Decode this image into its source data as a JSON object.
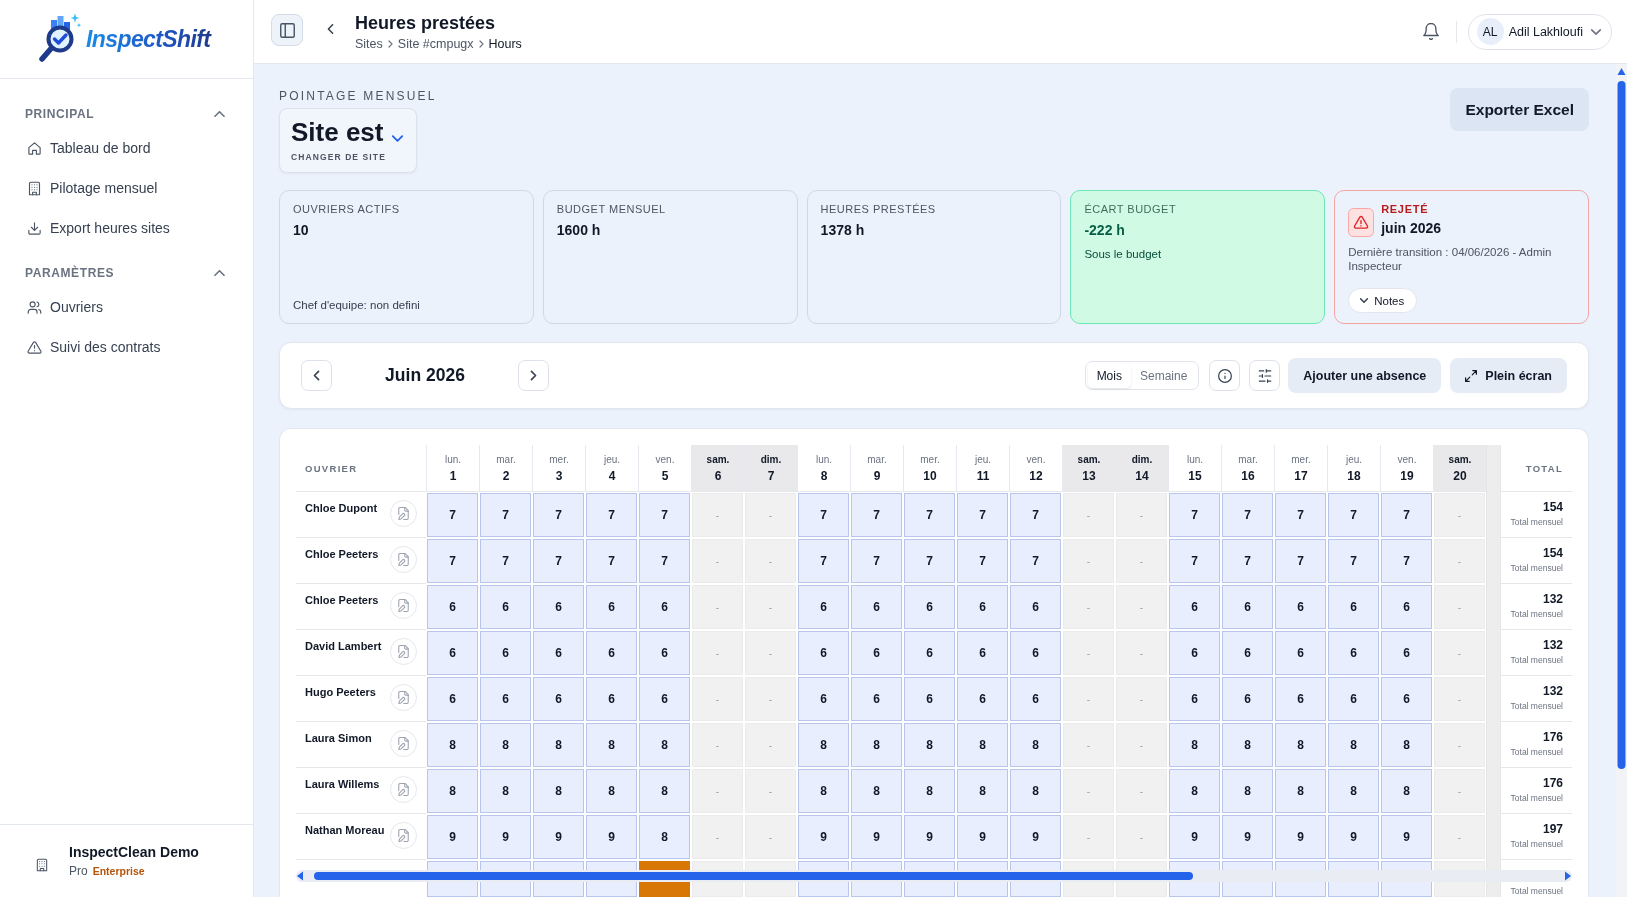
{
  "sidebar": {
    "logo": "InspectShift",
    "sections": [
      {
        "title": "PRINCIPAL",
        "expanded": true,
        "items": [
          {
            "label": "Tableau de bord",
            "selected": false
          },
          {
            "label": "Pilotage mensuel",
            "selected": false
          },
          {
            "label": "Export heures sites",
            "selected": false
          }
        ]
      },
      {
        "title": "PARAMÈTRES",
        "expanded": true,
        "items": [
          {
            "label": "Ouvriers",
            "selected": false
          },
          {
            "label": "Suivi des contrats",
            "selected": false
          }
        ]
      }
    ],
    "organization": {
      "name": "InspectClean Demo",
      "plan": "Pro",
      "tier": "Enterprise"
    }
  },
  "header": {
    "title": "Heures prestées",
    "breadcrumb": [
      {
        "label": "Sites",
        "current": false
      },
      {
        "label": "Site #cmpugx",
        "current": false
      },
      {
        "label": "Hours",
        "current": true
      }
    ],
    "user": {
      "initials": "AL",
      "name": "Adil Lakhloufi"
    }
  },
  "page": {
    "eyebrow": "POINTAGE MENSUEL",
    "site": {
      "name": "Site est",
      "action": "CHANGER DE SITE"
    },
    "export_button": "Exporter Excel"
  },
  "stats": [
    {
      "kind": "stat",
      "label": "OUVRIERS ACTIFS",
      "value": "10",
      "note": "Chef d'equipe: non defini"
    },
    {
      "kind": "stat",
      "label": "BUDGET MENSUEL",
      "value": "1600 h"
    },
    {
      "kind": "stat",
      "label": "HEURES PRESTÉES",
      "value": "1378 h"
    },
    {
      "kind": "positive",
      "label": "ÉCART BUDGET",
      "value": "-222 h",
      "note": "Sous le budget"
    },
    {
      "kind": "status",
      "label": "REJETÉ",
      "value": "juin 2026",
      "note": "Dernière transition : 04/06/2026 - Admin Inspecteur",
      "button": "Notes"
    }
  ],
  "toolbar": {
    "month": "Juin 2026",
    "view_modes": [
      {
        "label": "Mois",
        "selected": true
      },
      {
        "label": "Semaine",
        "selected": false
      }
    ],
    "add_absence": "Ajouter une absence",
    "fullscreen": "Plein écran"
  },
  "table": {
    "worker_header": "OUVRIER",
    "total_header": "TOTAL",
    "days": [
      {
        "weekday": "lun.",
        "day": "1",
        "weekend": false
      },
      {
        "weekday": "mar.",
        "day": "2",
        "weekend": false
      },
      {
        "weekday": "mer.",
        "day": "3",
        "weekend": false
      },
      {
        "weekday": "jeu.",
        "day": "4",
        "weekend": false
      },
      {
        "weekday": "ven.",
        "day": "5",
        "weekend": false
      },
      {
        "weekday": "sam.",
        "day": "6",
        "weekend": true
      },
      {
        "weekday": "dim.",
        "day": "7",
        "weekend": true
      },
      {
        "weekday": "lun.",
        "day": "8",
        "weekend": false
      },
      {
        "weekday": "mar.",
        "day": "9",
        "weekend": false
      },
      {
        "weekday": "mer.",
        "day": "10",
        "weekend": false
      },
      {
        "weekday": "jeu.",
        "day": "11",
        "weekend": false
      },
      {
        "weekday": "ven.",
        "day": "12",
        "weekend": false
      },
      {
        "weekday": "sam.",
        "day": "13",
        "weekend": true
      },
      {
        "weekday": "dim.",
        "day": "14",
        "weekend": true
      },
      {
        "weekday": "lun.",
        "day": "15",
        "weekend": false
      },
      {
        "weekday": "mar.",
        "day": "16",
        "weekend": false
      },
      {
        "weekday": "mer.",
        "day": "17",
        "weekend": false
      },
      {
        "weekday": "jeu.",
        "day": "18",
        "weekend": false
      },
      {
        "weekday": "ven.",
        "day": "19",
        "weekend": false
      },
      {
        "weekday": "sam.",
        "day": "20",
        "weekend": true
      }
    ],
    "rows": [
      {
        "name": "Chloe Dupont",
        "cells": [
          "7",
          "7",
          "7",
          "7",
          "7",
          "-",
          "-",
          "7",
          "7",
          "7",
          "7",
          "7",
          "-",
          "-",
          "7",
          "7",
          "7",
          "7",
          "7",
          "-"
        ],
        "total": "154",
        "total_label": "Total mensuel"
      },
      {
        "name": "Chloe Peeters",
        "cells": [
          "7",
          "7",
          "7",
          "7",
          "7",
          "-",
          "-",
          "7",
          "7",
          "7",
          "7",
          "7",
          "-",
          "-",
          "7",
          "7",
          "7",
          "7",
          "7",
          "-"
        ],
        "total": "154",
        "total_label": "Total mensuel"
      },
      {
        "name": "Chloe Peeters",
        "cells": [
          "6",
          "6",
          "6",
          "6",
          "6",
          "-",
          "-",
          "6",
          "6",
          "6",
          "6",
          "6",
          "-",
          "-",
          "6",
          "6",
          "6",
          "6",
          "6",
          "-"
        ],
        "total": "132",
        "total_label": "Total mensuel"
      },
      {
        "name": "David Lambert",
        "cells": [
          "6",
          "6",
          "6",
          "6",
          "6",
          "-",
          "-",
          "6",
          "6",
          "6",
          "6",
          "6",
          "-",
          "-",
          "6",
          "6",
          "6",
          "6",
          "6",
          "-"
        ],
        "total": "132",
        "total_label": "Total mensuel"
      },
      {
        "name": "Hugo Peeters",
        "cells": [
          "6",
          "6",
          "6",
          "6",
          "6",
          "-",
          "-",
          "6",
          "6",
          "6",
          "6",
          "6",
          "-",
          "-",
          "6",
          "6",
          "6",
          "6",
          "6",
          "-"
        ],
        "total": "132",
        "total_label": "Total mensuel"
      },
      {
        "name": "Laura Simon",
        "cells": [
          "8",
          "8",
          "8",
          "8",
          "8",
          "-",
          "-",
          "8",
          "8",
          "8",
          "8",
          "8",
          "-",
          "-",
          "8",
          "8",
          "8",
          "8",
          "8",
          "-"
        ],
        "total": "176",
        "total_label": "Total mensuel"
      },
      {
        "name": "Laura Willems",
        "cells": [
          "8",
          "8",
          "8",
          "8",
          "8",
          "-",
          "-",
          "8",
          "8",
          "8",
          "8",
          "8",
          "-",
          "-",
          "8",
          "8",
          "8",
          "8",
          "8",
          "-"
        ],
        "total": "176",
        "total_label": "Total mensuel"
      },
      {
        "name": "Nathan Moreau",
        "cells": [
          "9",
          "9",
          "9",
          "9",
          "8",
          "-",
          "-",
          "9",
          "9",
          "9",
          "9",
          "9",
          "-",
          "-",
          "9",
          "9",
          "9",
          "9",
          "9",
          "-"
        ],
        "total": "197",
        "total_label": "Total mensuel"
      }
    ],
    "partial_row": {
      "cells": [
        {
          "highlighted": false
        },
        {
          "highlighted": false
        },
        {
          "highlighted": false
        },
        {
          "highlighted": false
        },
        {
          "highlighted": true
        },
        {
          "highlighted": false
        },
        {
          "highlighted": false
        },
        {
          "highlighted": false
        },
        {
          "highlighted": false
        },
        {
          "highlighted": false
        },
        {
          "highlighted": false
        },
        {
          "highlighted": false
        },
        {
          "highlighted": false
        },
        {
          "highlighted": false
        },
        {
          "highlighted": false
        },
        {
          "highlighted": false
        },
        {
          "highlighted": false
        },
        {
          "highlighted": false
        },
        {
          "highlighted": false
        },
        {
          "highlighted": false
        }
      ],
      "total_label": "Total mensuel"
    }
  }
}
